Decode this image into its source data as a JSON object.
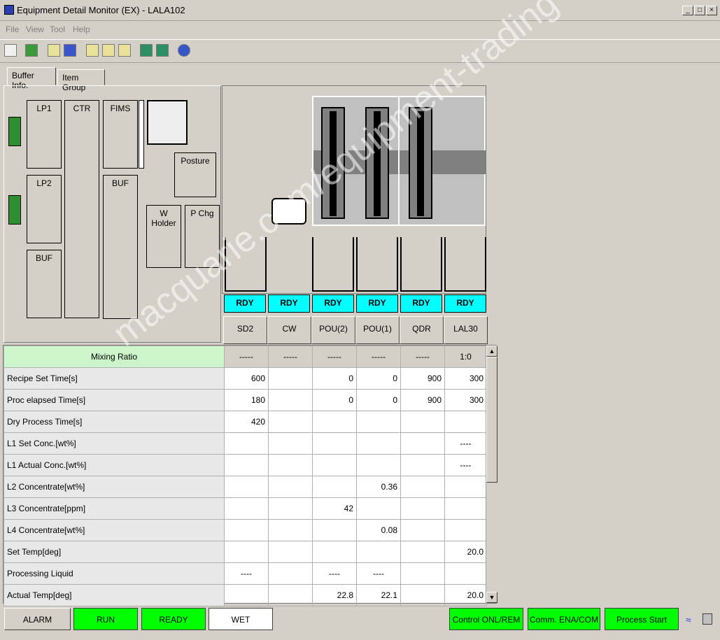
{
  "window": {
    "title": "Equipment Detail Monitor (EX) - LALA102"
  },
  "menu": [
    "File",
    "View",
    "Tool",
    "Help"
  ],
  "tabs": [
    "Buffer Info.",
    "Item Group"
  ],
  "layout_labels": {
    "lp1": "LP1",
    "ctr": "CTR",
    "fims": "FIMS",
    "lp2": "LP2",
    "buf1": "BUF",
    "buf2": "BUF",
    "posture": "Posture",
    "wholder": "W Holder",
    "pchg": "P Chg"
  },
  "units": [
    {
      "status": "RDY",
      "name": "SD2"
    },
    {
      "status": "RDY",
      "name": "CW"
    },
    {
      "status": "RDY",
      "name": "POU(2)"
    },
    {
      "status": "RDY",
      "name": "POU(1)"
    },
    {
      "status": "RDY",
      "name": "QDR"
    },
    {
      "status": "RDY",
      "name": "LAL30"
    }
  ],
  "table": {
    "header": {
      "label": "Mixing Ratio",
      "cells": [
        "-----",
        "-----",
        "-----",
        "-----",
        "-----",
        "1:0"
      ]
    },
    "rows": [
      {
        "label": "Recipe Set Time[s]",
        "cells": [
          "600",
          "",
          "0",
          "0",
          "900",
          "300"
        ]
      },
      {
        "label": "Proc elapsed Time[s]",
        "cells": [
          "180",
          "",
          "0",
          "0",
          "900",
          "300"
        ]
      },
      {
        "label": "Dry Process Time[s]",
        "cells": [
          "420",
          "",
          "",
          "",
          "",
          ""
        ]
      },
      {
        "label": "L1 Set Conc.[wt%]",
        "cells": [
          "",
          "",
          "",
          "",
          "",
          "----"
        ]
      },
      {
        "label": "L1 Actual Conc.[wt%]",
        "cells": [
          "",
          "",
          "",
          "",
          "",
          "----"
        ]
      },
      {
        "label": "L2 Concentrate[wt%]",
        "cells": [
          "",
          "",
          "",
          "0.36",
          "",
          ""
        ]
      },
      {
        "label": "L3 Concentrate[ppm]",
        "cells": [
          "",
          "",
          "42",
          "",
          "",
          ""
        ]
      },
      {
        "label": "L4 Concentrate[wt%]",
        "cells": [
          "",
          "",
          "",
          "0.08",
          "",
          ""
        ]
      },
      {
        "label": "Set Temp[deg]",
        "cells": [
          "",
          "",
          "",
          "",
          "",
          "20.0"
        ]
      },
      {
        "label": "Processing Liquid",
        "cells": [
          "----",
          "",
          "----",
          "----",
          "",
          ""
        ]
      },
      {
        "label": "Actual Temp[deg]",
        "cells": [
          "",
          "",
          "22.8",
          "22.1",
          "",
          "20.0"
        ]
      }
    ]
  },
  "statusbar": {
    "alarm": "ALARM",
    "run": "RUN",
    "ready": "READY",
    "wet": "WET",
    "control": "Control ONL/REM",
    "comm": "Comm. ENA/COM",
    "process": "Process Start"
  },
  "watermark": "macquarie.com/equipment-trading",
  "colors": {
    "rdy": "#00ffff",
    "green": "#00ff00",
    "mixing": "#ccf5cc"
  }
}
